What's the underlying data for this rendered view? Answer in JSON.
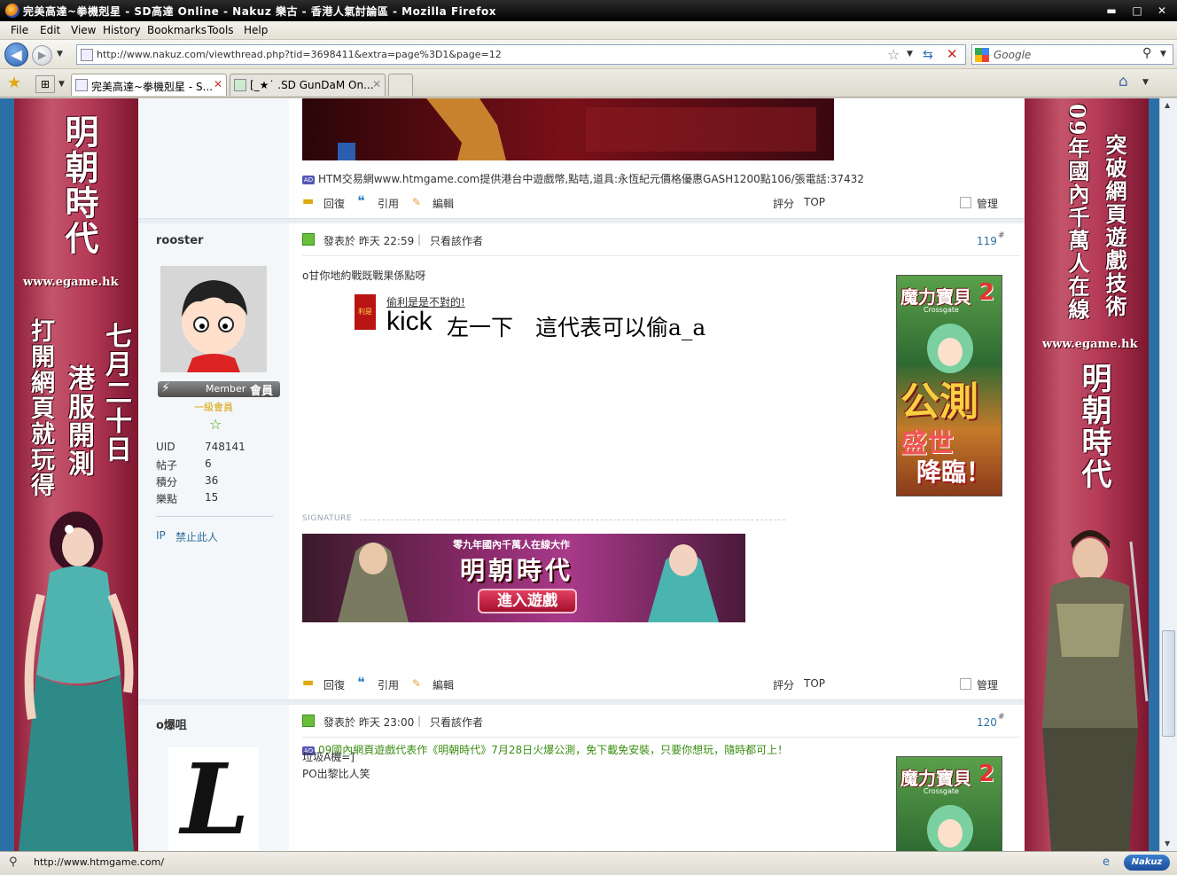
{
  "window": {
    "title": "完美高達~拳機剋星 - SD高達 Online - Nakuz 樂古 - 香港人氣討論區 - Mozilla Firefox",
    "min_glyph": "▬",
    "max_glyph": "□",
    "close_glyph": "✕"
  },
  "menu": [
    "File",
    "Edit",
    "View",
    "History",
    "Bookmarks",
    "Tools",
    "Help"
  ],
  "nav": {
    "url": "http://www.nakuz.com/viewthread.php?tid=3698411&extra=page%3D1&page=12",
    "search_placeholder": "Google"
  },
  "tabs": [
    {
      "label": "完美高達~拳機剋星 - S...",
      "active": true
    },
    {
      "label": "[_★˙ .SD GunDaM On...",
      "active": false
    }
  ],
  "left_banner": {
    "title": "明朝時代",
    "site": "www.egame.hk",
    "slogan_a": "七月二十日",
    "slogan_b": "港服開測",
    "slogan_c": "打開網頁就玩得"
  },
  "right_banner": {
    "slogan_a": "突破網頁遊戲技術",
    "slogan_b": "09年國內千萬人在線",
    "site": "www.egame.hk",
    "title": "明朝時代"
  },
  "prev_post": {
    "ad_text": "HTM交易網www.htmgame.com提供港台中遊戲幣,點咭,道具:永恆紀元價格優惠GASH1200點106/張電話:37432",
    "actions": {
      "reply": "回復",
      "quote": "引用",
      "edit": "編輯",
      "rate": "評分",
      "top": "TOP",
      "manage": "管理"
    }
  },
  "post1": {
    "username": "rooster",
    "rank_badge": "Member",
    "rank_badge_cn": "會員",
    "rank_title": "一級會員",
    "stats": [
      {
        "label": "UID",
        "value": "748141"
      },
      {
        "label": "帖子",
        "value": "6"
      },
      {
        "label": "積分",
        "value": "36"
      },
      {
        "label": "樂點",
        "value": "15"
      }
    ],
    "links": {
      "ip": "IP",
      "ban": "禁止此人"
    },
    "posted": "發表於 昨天 22:59",
    "only_author": "只看該作者",
    "floor": "119",
    "floor_mark": "#",
    "body_line": "o甘你地約戰既戰果係點呀",
    "attach_title": "偷利是是不對的!",
    "attach_icon_text": "利是",
    "big_text_a": "kick",
    "big_text_b": "左一下　這代表可以偷a_a",
    "signature_label": "SIGNATURE",
    "sig_banner_top": "零九年國內千萬人在線大作",
    "sig_banner_title": "明朝時代",
    "sig_banner_button": "進入遊戲",
    "ad_text": "09國內網頁遊戲代表作《明朝時代》7月28日火爆公測，免下載免安裝，只要你想玩，隨時都可上！",
    "side_ad": {
      "title": "魔力寶貝",
      "title_num": "2",
      "subtitle": "Crossgate",
      "big": "公測",
      "line2": "盛世",
      "line3": "降臨！"
    },
    "actions": {
      "reply": "回復",
      "quote": "引用",
      "edit": "編輯",
      "rate": "評分",
      "top": "TOP",
      "manage": "管理"
    }
  },
  "post2": {
    "username": "o爆咀",
    "posted": "發表於 昨天 23:00",
    "only_author": "只看該作者",
    "floor": "120",
    "floor_mark": "#",
    "line1": "垃圾A機=]",
    "line2": "PO出黎比人笑",
    "avatar_letter": "L",
    "side_ad": {
      "title": "魔力寶貝",
      "title_num": "2",
      "subtitle": "Crossgate"
    }
  },
  "status": {
    "text": "http://www.htmgame.com/",
    "brand": "Nakuz"
  }
}
